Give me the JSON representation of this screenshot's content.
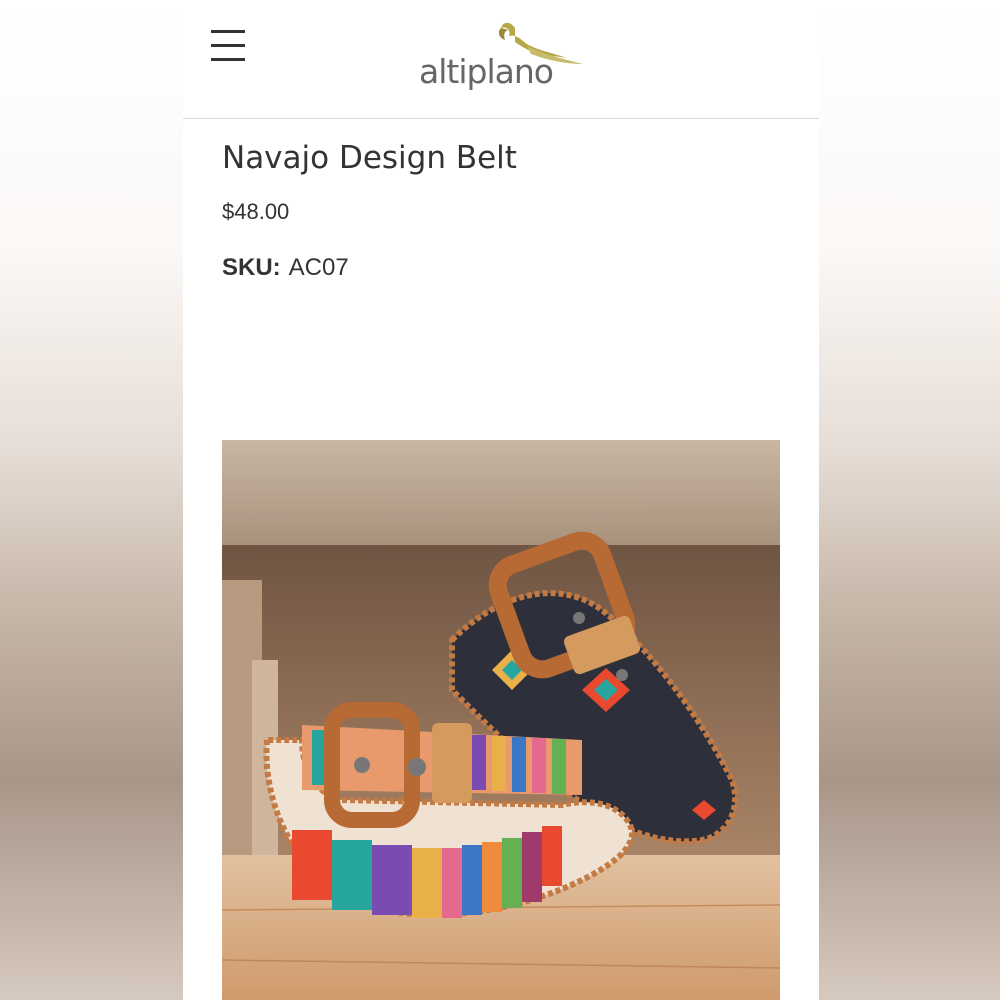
{
  "header": {
    "brand": "altiplano",
    "menu_icon": "hamburger-menu-icon",
    "logo_icon": "bird-icon"
  },
  "product": {
    "title": "Navajo Design Belt",
    "price": "$48.00",
    "sku_label": "SKU:",
    "sku_value": "AC07",
    "image_alt": "product-photo-belts"
  },
  "colors": {
    "text": "#333333",
    "logo_text": "#666666",
    "logo_accent": "#b6a646",
    "divider": "#d9d9d9"
  }
}
